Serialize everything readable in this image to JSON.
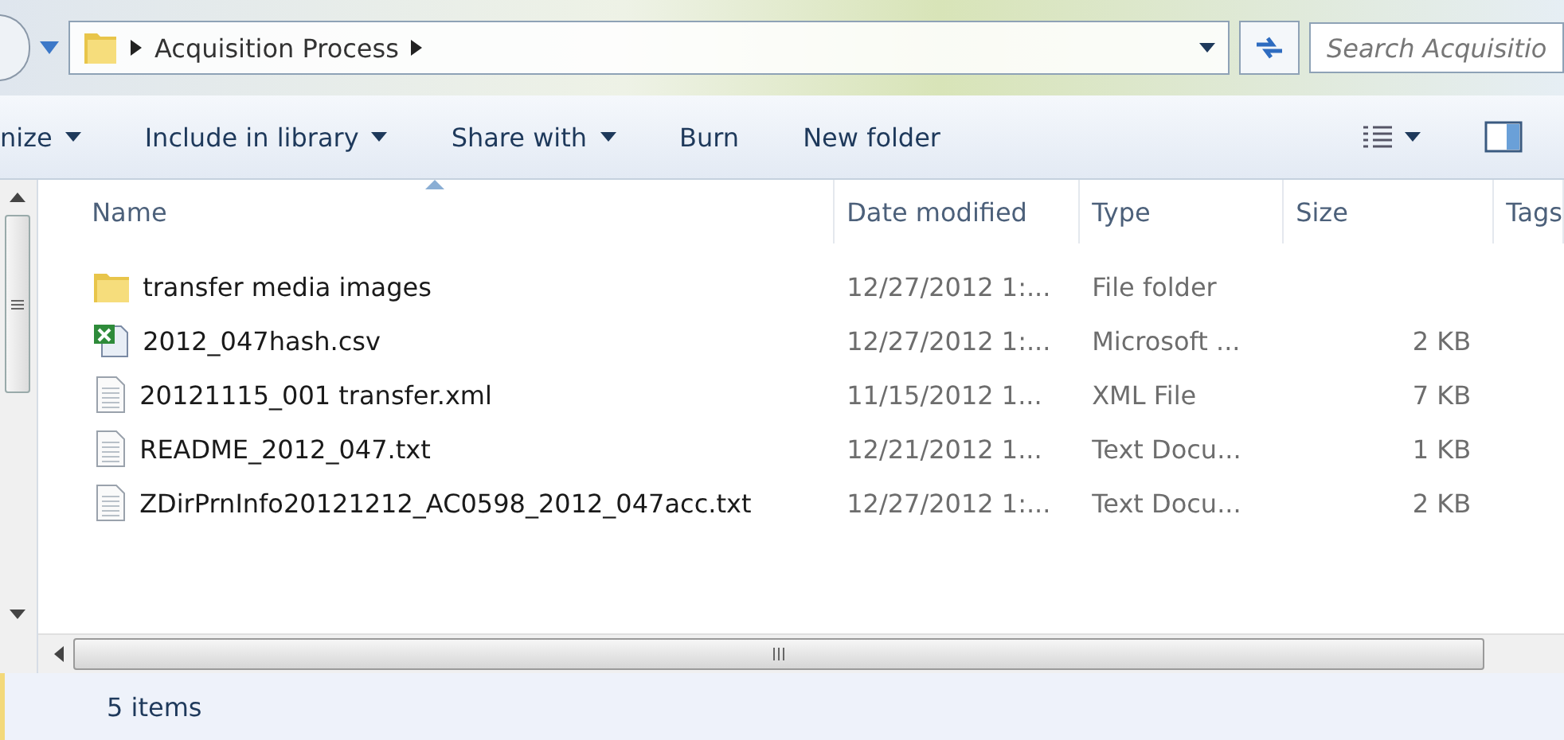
{
  "address_bar": {
    "path": [
      "Acquisition Process"
    ],
    "search_placeholder": "Search Acquisitio"
  },
  "toolbar": {
    "items": [
      {
        "label": "nize",
        "menu": true
      },
      {
        "label": "Include in library",
        "menu": true
      },
      {
        "label": "Share with",
        "menu": true
      },
      {
        "label": "Burn",
        "menu": false
      },
      {
        "label": "New folder",
        "menu": false
      }
    ]
  },
  "table": {
    "columns": [
      {
        "label": "Name",
        "sorted": true
      },
      {
        "label": "Date modified",
        "sorted": false
      },
      {
        "label": "Type",
        "sorted": false
      },
      {
        "label": "Size",
        "sorted": false
      },
      {
        "label": "Tags",
        "sorted": false
      }
    ],
    "rows": [
      {
        "kind": "folder",
        "name": "transfer media images",
        "date": "12/27/2012 1:...",
        "type": "File folder",
        "size": ""
      },
      {
        "kind": "spreadsheet",
        "name": "2012_047hash.csv",
        "date": "12/27/2012 1:...",
        "type": "Microsoft ...",
        "size": "2 KB"
      },
      {
        "kind": "text",
        "name": "20121115_001 transfer.xml",
        "date": "11/15/2012 1...",
        "type": "XML File",
        "size": "7 KB"
      },
      {
        "kind": "text",
        "name": "README_2012_047.txt",
        "date": "12/21/2012 1...",
        "type": "Text Docu...",
        "size": "1 KB"
      },
      {
        "kind": "text",
        "name": "ZDirPrnInfo20121212_AC0598_2012_047acc.txt",
        "date": "12/27/2012 1:...",
        "type": "Text Docu...",
        "size": "2 KB"
      }
    ]
  },
  "status_bar": {
    "text": "5 items"
  }
}
